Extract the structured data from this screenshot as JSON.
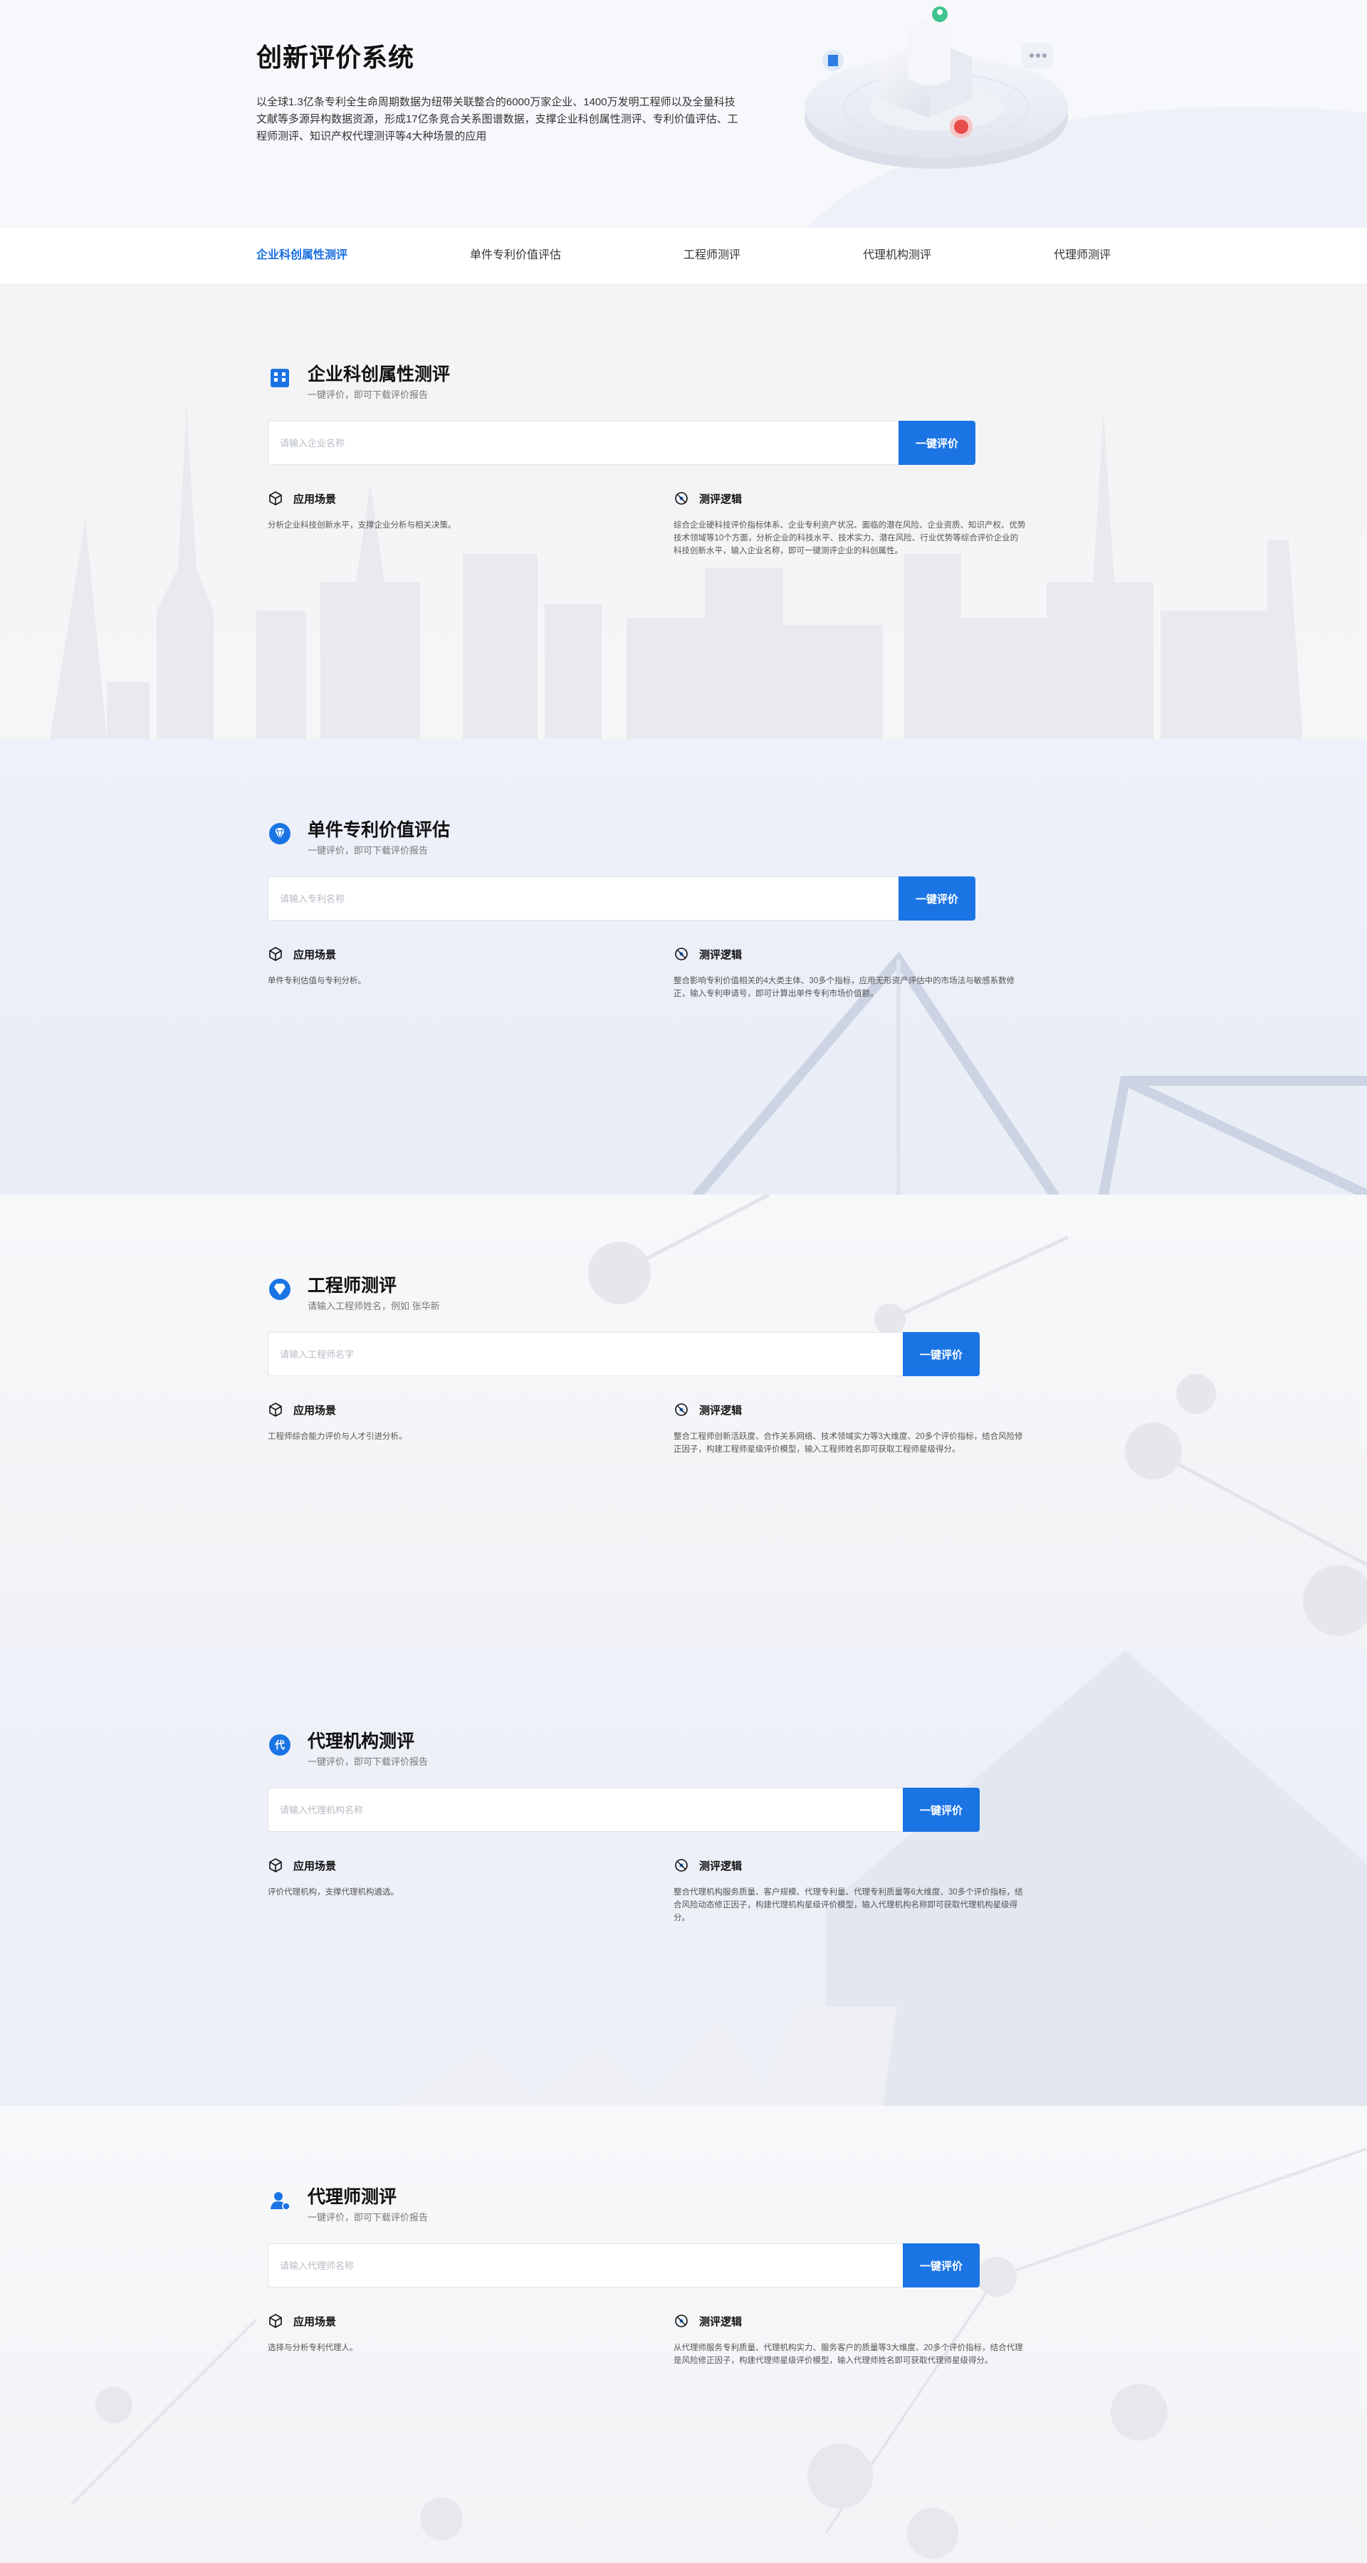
{
  "hero": {
    "title": "创新评价系统",
    "description": "以全球1.3亿条专利全生命周期数据为纽带关联整合的6000万家企业、1400万发明工程师以及全量科技文献等多源异构数据资源，形成17亿条竞合关系图谱数据，支撑企业科创属性测评、专利价值评估、工程师测评、知识产权代理测评等4大种场景的应用"
  },
  "tabs": [
    {
      "label": "企业科创属性测评",
      "active": true
    },
    {
      "label": "单件专利价值评估",
      "active": false
    },
    {
      "label": "工程师测评",
      "active": false
    },
    {
      "label": "代理机构测评",
      "active": false
    },
    {
      "label": "代理师测评",
      "active": false
    }
  ],
  "sections": [
    {
      "title": "企业科创属性测评",
      "subtitle": "一键评价，即可下载评价报告",
      "icon": "building-icon",
      "placeholder": "请输入企业名称",
      "button": "一键评价",
      "scene_title": "应用场景",
      "scene_text": "分析企业科技创新水平，支撑企业分析与相关决策。",
      "logic_title": "测评逻辑",
      "logic_text": "综合企业硬科技评价指标体系、企业专利资产状况、面临的潜在风险、企业资质、知识产权、优势技术领域等10个方面，分析企业的科技水平、技术实力、潜在风险、行业优势等综合评价企业的科技创新水平，输入企业名称，即可一键测评企业的科创属性。"
    },
    {
      "title": "单件专利价值评估",
      "subtitle": "一键评价，即可下载评价报告",
      "icon": "diamond-icon",
      "placeholder": "请输入专利名称",
      "button": "一键评价",
      "scene_title": "应用场景",
      "scene_text": "单件专利估值与专利分析。",
      "logic_title": "测评逻辑",
      "logic_text": "整合影响专利价值相关的4大类主体、30多个指标，应用无形资产评估中的市场法与敏感系数修正，输入专利申请号，即可计算出单件专利市场价值额。"
    },
    {
      "title": "工程师测评",
      "subtitle": "请输入工程师姓名，例如 张华新",
      "icon": "gem-icon",
      "placeholder": "请输入工程师名字",
      "button": "一键评价",
      "scene_title": "应用场景",
      "scene_text": "工程师综合能力评价与人才引进分析。",
      "logic_title": "测评逻辑",
      "logic_text": "整合工程师创新活跃度、合作关系网络、技术领域实力等3大维度、20多个评价指标，结合风险修正因子，构建工程师星级评价模型，输入工程师姓名即可获取工程师星级得分。"
    },
    {
      "title": "代理机构测评",
      "subtitle": "一键评价，即可下载评价报告",
      "icon": "agency-icon",
      "placeholder": "请输入代理机构名称",
      "button": "一键评价",
      "scene_title": "应用场景",
      "scene_text": "评价代理机构，支撑代理机构遴选。",
      "logic_title": "测评逻辑",
      "logic_text": "整合代理机构服务质量、客户规模、代理专利量、代理专利质量等6大维度、30多个评价指标，结合风险动态修正因子，构建代理机构星级评价模型，输入代理机构名称即可获取代理机构星级得分。"
    },
    {
      "title": "代理师测评",
      "subtitle": "一键评价，即可下载评价报告",
      "icon": "user-gear-icon",
      "placeholder": "请输入代理师名称",
      "button": "一键评价",
      "scene_title": "应用场景",
      "scene_text": "选择与分析专利代理人。",
      "logic_title": "测评逻辑",
      "logic_text": "从代理师服务专利质量、代理机构实力、服务客户的质量等3大维度、20多个评价指标，结合代理是风险修正因子，构建代理师星级评价模型，输入代理师姓名即可获取代理师星级得分。"
    }
  ],
  "colors": {
    "accent": "#1b74e4",
    "active_tab": "#1a6fe0"
  }
}
